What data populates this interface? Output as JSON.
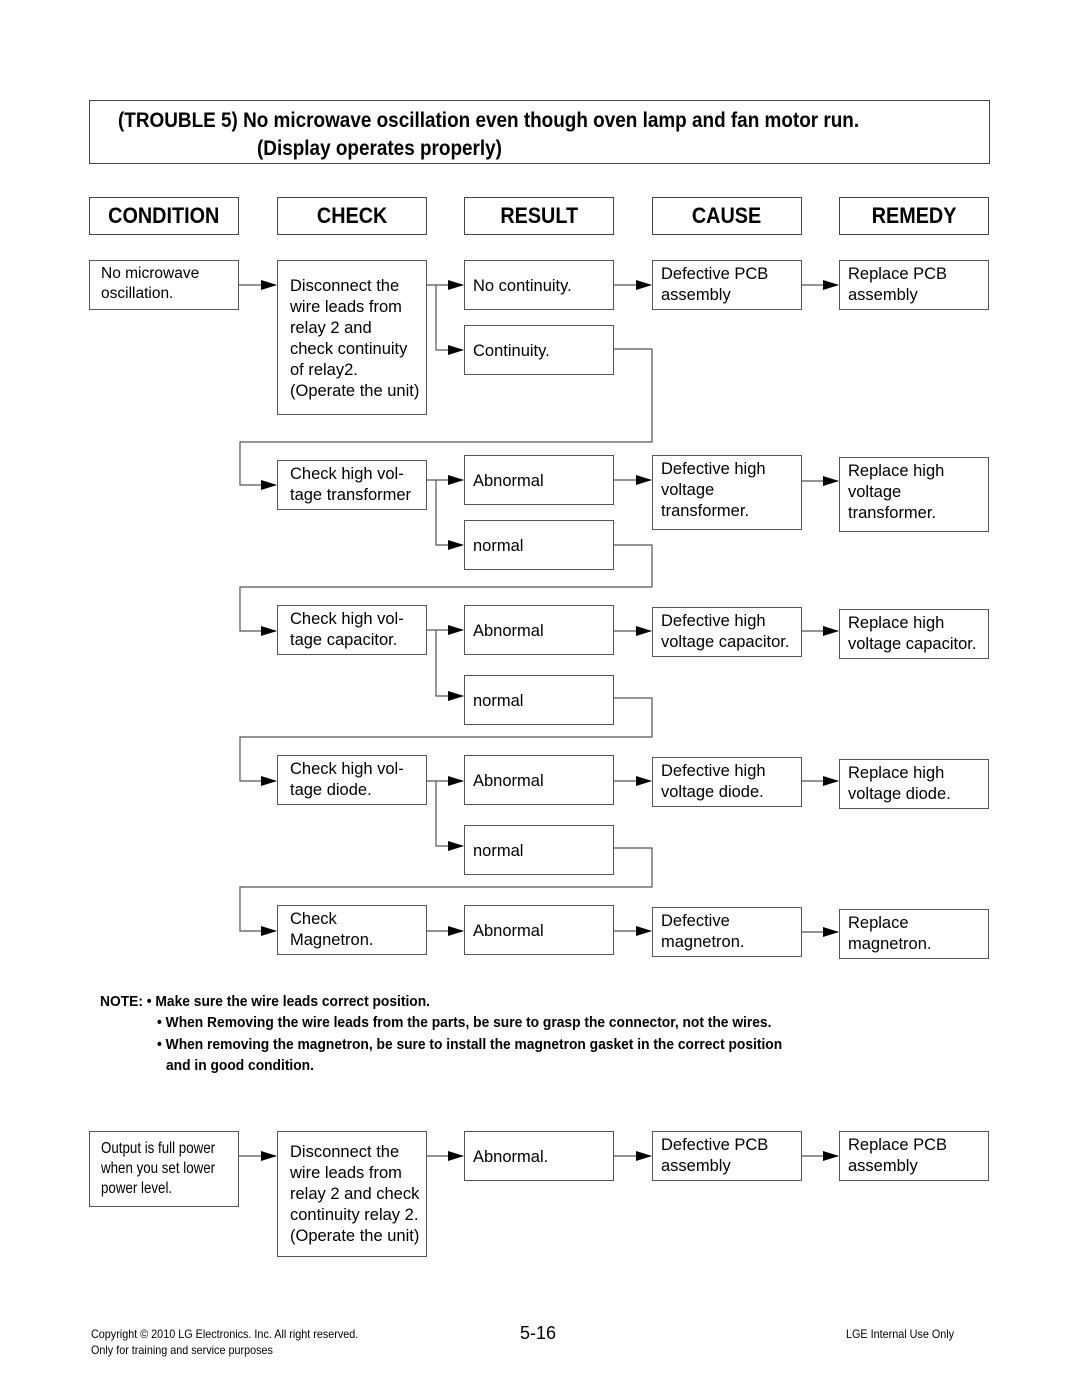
{
  "title": {
    "line1": "(TROUBLE 5) No microwave oscillation even though oven lamp and fan motor run.",
    "line2": "(Display operates properly)"
  },
  "headers": [
    "CONDITION",
    "CHECK",
    "RESULT",
    "CAUSE",
    "REMEDY"
  ],
  "flow1": {
    "condition": "No microwave\noscillation.",
    "check": "Disconnect the\nwire leads from\nrelay 2 and\ncheck continuity\nof relay2.\n(Operate the unit)",
    "result_a": "No continuity.",
    "result_b": "Continuity.",
    "cause": "Defective PCB\nassembly",
    "remedy": "Replace PCB\nassembly"
  },
  "flow2": {
    "check": "Check high vol-\ntage transformer",
    "result_a": "Abnormal",
    "result_b": "normal",
    "cause": "Defective high\nvoltage\ntransformer.",
    "remedy": "Replace high\nvoltage\ntransformer."
  },
  "flow3": {
    "check": "Check high vol-\ntage capacitor.",
    "result_a": "Abnormal",
    "result_b": "normal",
    "cause": "Defective high\nvoltage capacitor.",
    "remedy": "Replace high\nvoltage capacitor."
  },
  "flow4": {
    "check": "Check high vol-\ntage diode.",
    "result_a": "Abnormal",
    "result_b": "normal",
    "cause": "Defective high\nvoltage diode.",
    "remedy": "Replace high\nvoltage diode."
  },
  "flow5": {
    "check": "Check\nMagnetron.",
    "result_a": "Abnormal",
    "cause": "Defective\nmagnetron.",
    "remedy": "Replace\nmagnetron."
  },
  "notes": {
    "prefix": "NOTE: • Make sure the wire leads correct position.",
    "item2": "• When Removing the wire leads from the parts, be sure to grasp the connector, not the wires.",
    "item3_line1": "• When removing the magnetron, be sure to install the magnetron gasket in the correct position",
    "item3_line2": "and in good condition."
  },
  "flow6": {
    "condition": "Output is full power\nwhen you set lower\npower level.",
    "check": "Disconnect the\nwire leads from\nrelay 2 and check\ncontinuity relay 2.\n(Operate the unit)",
    "result_a": "Abnormal.",
    "cause": "Defective PCB\nassembly",
    "remedy": "Replace PCB\nassembly"
  },
  "footer": {
    "copyright": "Copyright © 2010 LG Electronics. Inc. All right reserved.",
    "training": "Only for training and service purposes",
    "page_number": "5-16",
    "internal": "LGE Internal Use Only"
  }
}
